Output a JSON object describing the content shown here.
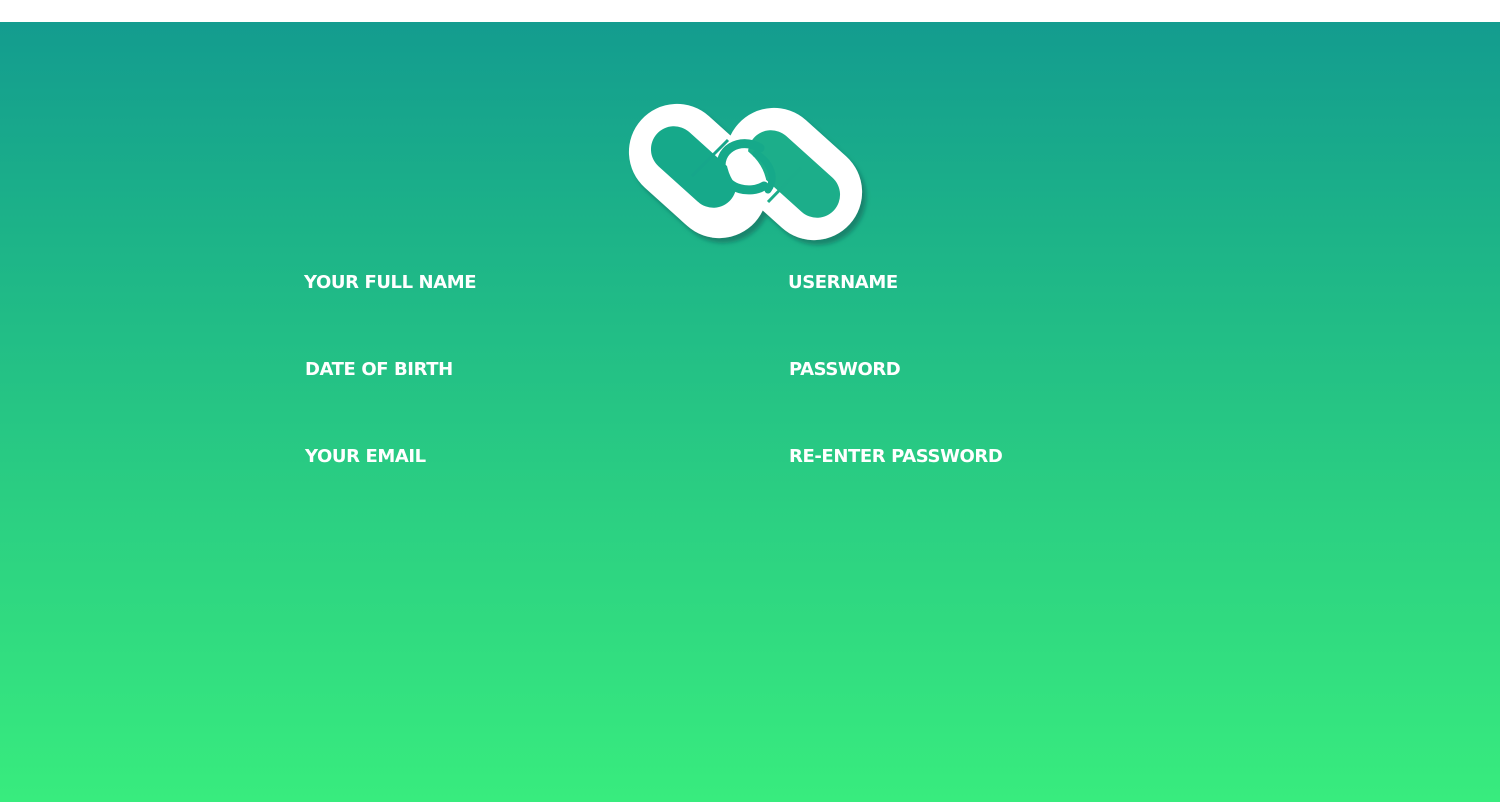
{
  "colors": {
    "gradient_top": "#139c8f",
    "gradient_bottom": "#38ec7e",
    "label_color": "#ffffff"
  },
  "logo": {
    "icon": "interlocked-chain-links-icon"
  },
  "form": {
    "full_name": {
      "label": "YOUR FULL NAME",
      "value": ""
    },
    "username": {
      "label": "USERNAME",
      "value": ""
    },
    "date_of_birth": {
      "label": "DATE OF BIRTH",
      "value": ""
    },
    "password": {
      "label": "PASSWORD",
      "value": ""
    },
    "email": {
      "label": "YOUR EMAIL",
      "value": ""
    },
    "reenter_password": {
      "label": "RE-ENTER PASSWORD",
      "value": ""
    }
  }
}
